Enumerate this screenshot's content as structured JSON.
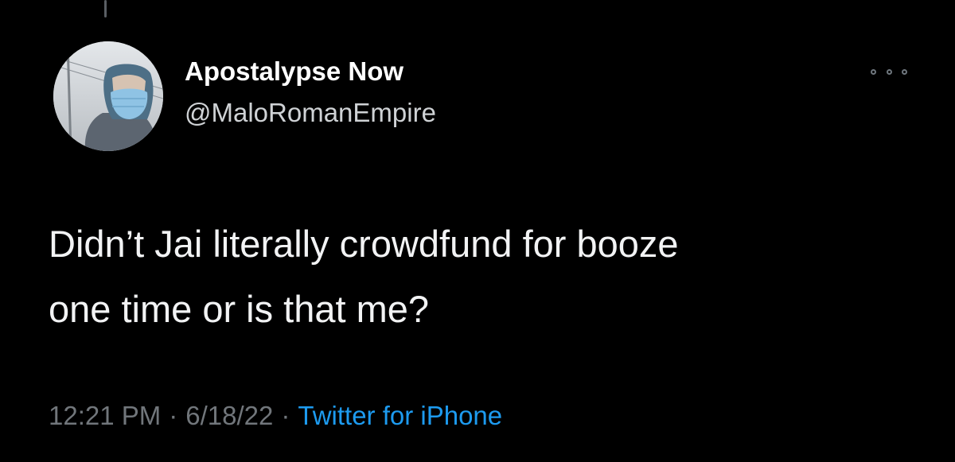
{
  "author": {
    "display_name": "Apostalypse Now",
    "handle": "@MaloRomanEmpire"
  },
  "tweet": {
    "lines": [
      "Didn’t Jai literally crowdfund for booze",
      "one time or is that me?"
    ]
  },
  "meta": {
    "time": "12:21 PM",
    "date": "6/18/22",
    "source": "Twitter for iPhone",
    "separator": "·"
  },
  "icons": {
    "more": "more-horizontal-icon"
  },
  "colors": {
    "background": "#000000",
    "text": "#f2f3f4",
    "secondary": "#71767b",
    "link": "#1d9bf0"
  }
}
